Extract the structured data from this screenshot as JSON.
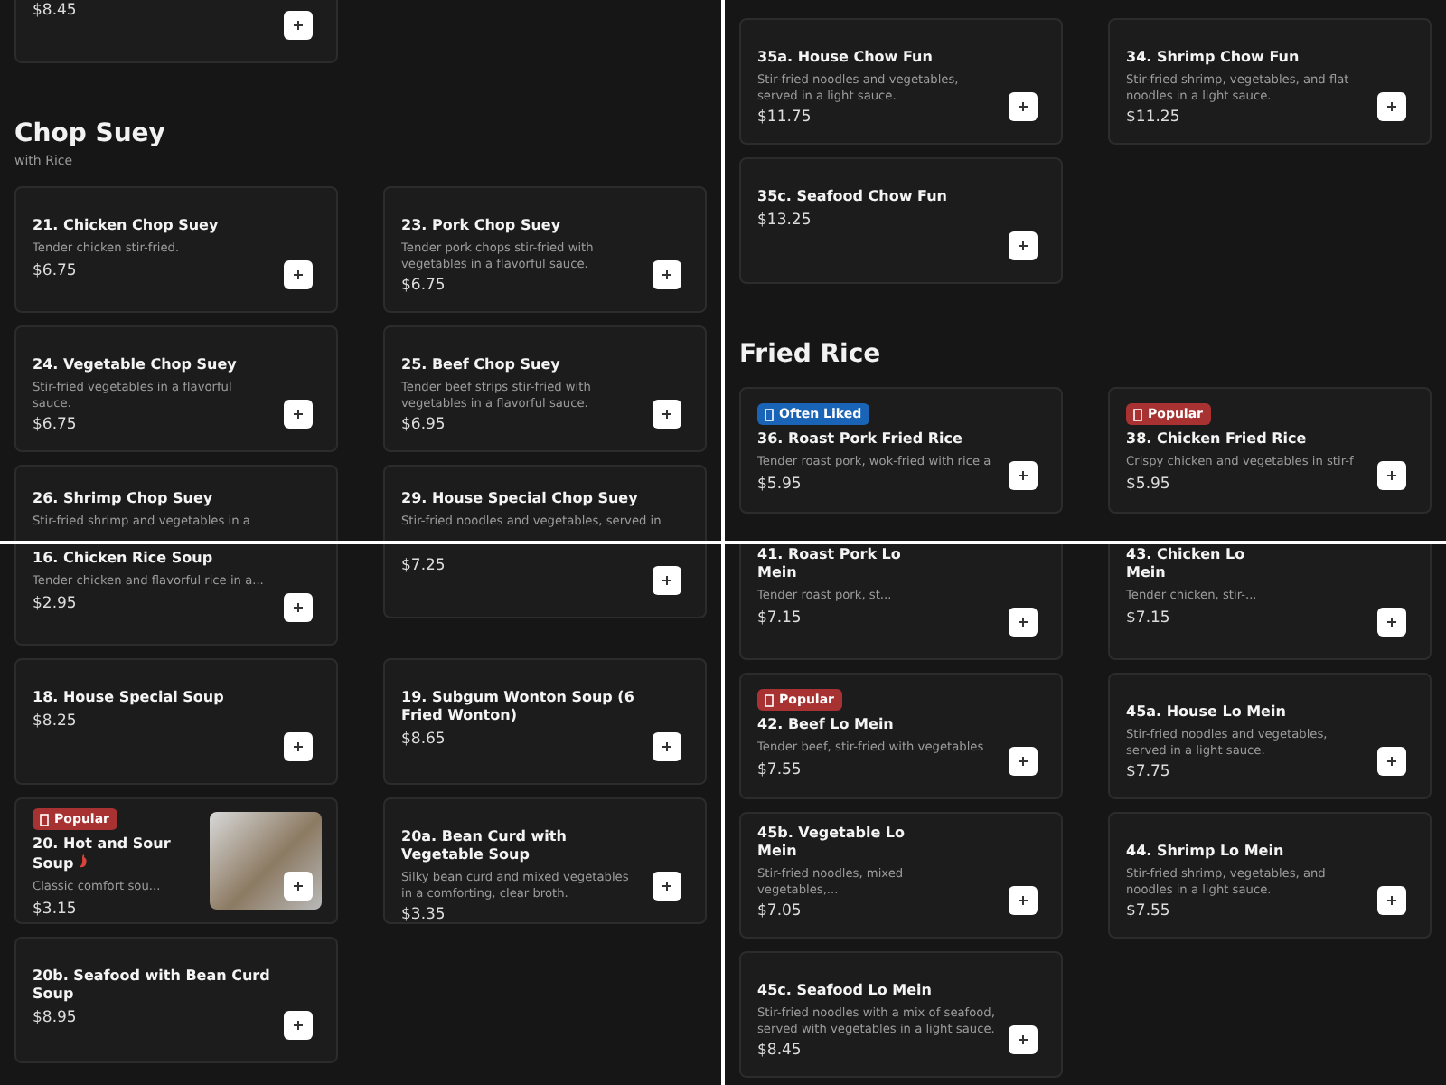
{
  "panels": [
    {
      "blocks": [
        {
          "kind": "grid",
          "cards": [
            {
              "kind": "price_only",
              "price": "$8.45"
            }
          ]
        },
        {
          "kind": "heading",
          "title": "Chop Suey",
          "subtitle": "with Rice"
        },
        {
          "kind": "grid",
          "cards": [
            {
              "kind": "plain",
              "title": "21. Chicken Chop Suey",
              "description": "Tender chicken stir-fried.",
              "price": "$6.75"
            },
            {
              "kind": "plain",
              "title": "23. Pork Chop Suey",
              "description": "Tender pork chops stir-fried with vegetables in a flavorful sauce.",
              "price": "$6.75"
            },
            {
              "kind": "plain",
              "title": "24. Vegetable Chop Suey",
              "description": "Stir-fried vegetables in a flavorful sauce.",
              "price": "$6.75"
            },
            {
              "kind": "plain",
              "title": "25. Beef Chop Suey",
              "description": "Tender beef strips stir-fried with vegetables in a flavorful sauce.",
              "price": "$6.95"
            },
            {
              "kind": "cut_bottom",
              "title": "26. Shrimp Chop Suey",
              "description": "Stir-fried shrimp and vegetables in a"
            },
            {
              "kind": "cut_bottom",
              "title": "29. House Special Chop Suey",
              "description": "Stir-fried noodles and vegetables, served in"
            }
          ]
        }
      ]
    },
    {
      "blocks": [
        {
          "kind": "grid",
          "cards": [
            {
              "kind": "plain",
              "title": "35a. House Chow Fun",
              "description": "Stir-fried noodles and vegetables, served in a light sauce.",
              "price": "$11.75"
            },
            {
              "kind": "plain",
              "title": "34. Shrimp Chow Fun",
              "description": "Stir-fried shrimp, vegetables, and flat noodles in a light sauce.",
              "price": "$11.25"
            },
            {
              "kind": "plain",
              "title": "35c. Seafood Chow Fun",
              "price": "$13.25"
            }
          ]
        },
        {
          "kind": "heading",
          "title": "Fried Rice"
        },
        {
          "kind": "grid",
          "cards": [
            {
              "kind": "plain",
              "badge": {
                "label": "Often Liked",
                "color": "#1a64b8"
              },
              "title": "36. Roast Pork Fried Rice",
              "description": "Tender roast pork, wok-fried with rice a",
              "price": "$5.95"
            },
            {
              "kind": "plain",
              "badge": {
                "label": "Popular",
                "color": "#a83232"
              },
              "title": "38. Chicken Fried Rice",
              "description": "Crispy chicken and vegetables in stir-f",
              "price": "$5.95"
            }
          ]
        }
      ]
    },
    {
      "blocks": [
        {
          "kind": "grid",
          "cards": [
            {
              "kind": "plain",
              "title": "16. Chicken Rice Soup",
              "description": "Tender chicken and flavorful rice in a...",
              "price": "$2.95"
            },
            {
              "kind": "price_only",
              "price": "$7.25"
            }
          ]
        },
        {
          "kind": "grid",
          "cards": [
            {
              "kind": "plain",
              "title": "18. House Special Soup",
              "price": "$8.25"
            },
            {
              "kind": "plain",
              "title": "19. Subgum Wonton Soup (6 Fried Wonton)",
              "price": "$8.65"
            },
            {
              "kind": "photo",
              "badge": {
                "label": "Popular",
                "color": "#a83232"
              },
              "title": "20. Hot and Sour Soup",
              "spicy": true,
              "description": "Classic comfort sou...",
              "price": "$3.15"
            },
            {
              "kind": "plain",
              "title": "20a. Bean Curd with Vegetable Soup",
              "description": "Silky bean curd and mixed vegetables in a comforting, clear broth.",
              "price": "$3.35"
            },
            {
              "kind": "plain",
              "title": "20b. Seafood with Bean Curd Soup",
              "price": "$8.95"
            }
          ]
        }
      ]
    },
    {
      "blocks": [
        {
          "kind": "grid",
          "cards": [
            {
              "kind": "compact",
              "title": "41. Roast Pork Lo Mein",
              "description": "Tender roast pork, st...",
              "price": "$7.15"
            },
            {
              "kind": "compact",
              "title": "43. Chicken Lo Mein",
              "description": "Tender chicken, stir-...",
              "price": "$7.15"
            },
            {
              "kind": "plain",
              "badge": {
                "label": "Popular",
                "color": "#a83232"
              },
              "title": "42. Beef Lo Mein",
              "description": "Tender beef, stir-fried with vegetables",
              "price": "$7.55"
            },
            {
              "kind": "plain",
              "title": "45a. House Lo Mein",
              "description": "Stir-fried noodles and vegetables, served in a light sauce.",
              "price": "$7.75"
            },
            {
              "kind": "compact",
              "title": "45b. Vegetable Lo Mein",
              "description": "Stir-fried noodles, mixed vegetables,...",
              "price": "$7.05"
            },
            {
              "kind": "plain",
              "title": "44. Shrimp Lo Mein",
              "description": "Stir-fried shrimp, vegetables, and noodles in a light sauce.",
              "price": "$7.55"
            },
            {
              "kind": "plain",
              "title": "45c. Seafood Lo Mein",
              "description": "Stir-fried noodles with a mix of seafood, served with vegetables in a light sauce.",
              "price": "$8.45"
            }
          ]
        }
      ]
    }
  ]
}
